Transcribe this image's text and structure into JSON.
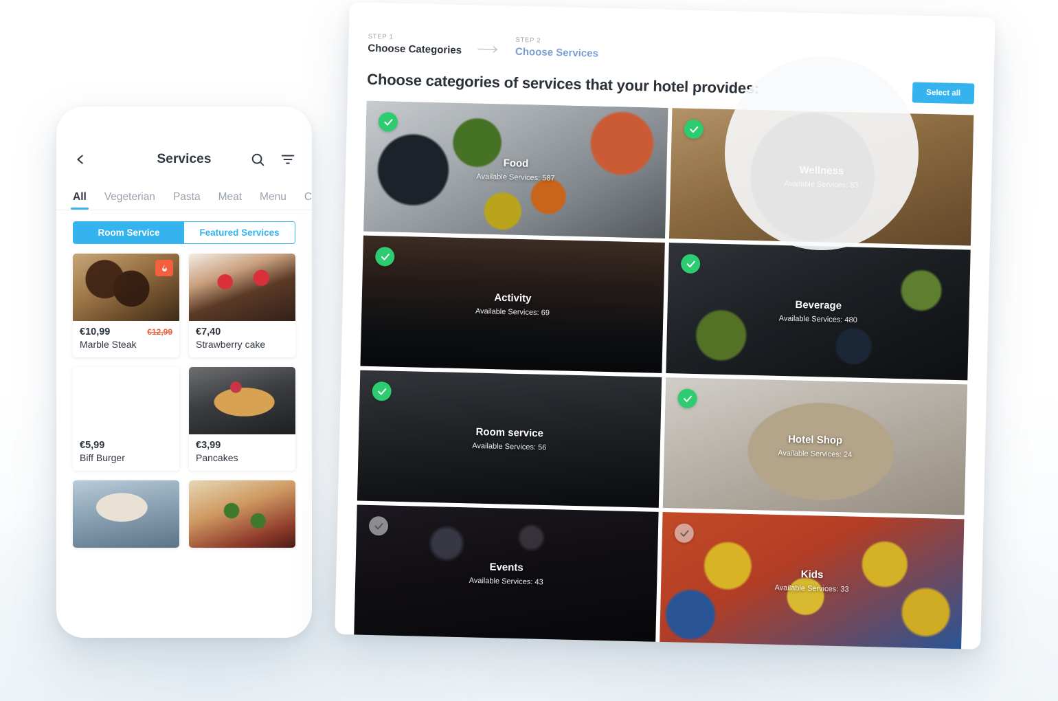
{
  "phone": {
    "title": "Services",
    "icons": {
      "back": "chevron-left-icon",
      "search": "search-icon",
      "filter": "filter-icon"
    },
    "tabs": [
      {
        "label": "All",
        "active": true
      },
      {
        "label": "Vegeterian",
        "active": false
      },
      {
        "label": "Pasta",
        "active": false
      },
      {
        "label": "Meat",
        "active": false
      },
      {
        "label": "Menu",
        "active": false
      },
      {
        "label": "Ch",
        "active": false
      }
    ],
    "segmented": [
      {
        "label": "Room Service",
        "active": true
      },
      {
        "label": "Featured Services",
        "active": false
      }
    ],
    "cards": [
      {
        "price": "€10,99",
        "old_price": "€12,99",
        "name": "Marble Steak",
        "badge": "flame-icon",
        "img": "img-steak"
      },
      {
        "price": "€7,40",
        "old_price": "",
        "name": "Strawberry cake",
        "badge": "",
        "img": "img-cake"
      },
      {
        "price": "€5,99",
        "old_price": "",
        "name": "Biff Burger",
        "badge": "",
        "img": "img-burger"
      },
      {
        "price": "€3,99",
        "old_price": "",
        "name": "Pancakes",
        "badge": "",
        "img": "img-pancake"
      },
      {
        "price": "",
        "old_price": "",
        "name": "",
        "badge": "",
        "img": "img-icecream"
      },
      {
        "price": "",
        "old_price": "",
        "name": "",
        "badge": "",
        "img": "img-pizza"
      }
    ]
  },
  "tablet": {
    "steps": [
      {
        "step_label": "STEP 1",
        "name": "Choose Categories",
        "active": true
      },
      {
        "step_label": "STEP 2",
        "name": "Choose Services",
        "active": false
      }
    ],
    "title": "Choose categories of services that your hotel provides:",
    "select_all": "Select all",
    "count_prefix": "Available Services:",
    "tiles": [
      {
        "name": "Food",
        "count": "587",
        "selected": true,
        "img": "tile-food"
      },
      {
        "name": "Wellness",
        "count": "83",
        "selected": true,
        "img": "tile-wellness"
      },
      {
        "name": "Activity",
        "count": "69",
        "selected": true,
        "img": "tile-activity",
        "dim": true
      },
      {
        "name": "Beverage",
        "count": "480",
        "selected": true,
        "img": "tile-beverage",
        "dim": true
      },
      {
        "name": "Room service",
        "count": "56",
        "selected": true,
        "img": "tile-roomservice",
        "dim": true
      },
      {
        "name": "Hotel Shop",
        "count": "24",
        "selected": true,
        "img": "tile-hotelshop"
      },
      {
        "name": "Events",
        "count": "43",
        "selected": false,
        "img": "tile-events",
        "dim": true
      },
      {
        "name": "Kids",
        "count": "33",
        "selected": false,
        "img": "tile-kids"
      }
    ]
  },
  "colors": {
    "accent_blue": "#34b3ef",
    "check_green": "#2ecc71",
    "sale_red": "#f4603e",
    "text_dark": "#2b3138",
    "text_muted": "#9aa3ad"
  }
}
